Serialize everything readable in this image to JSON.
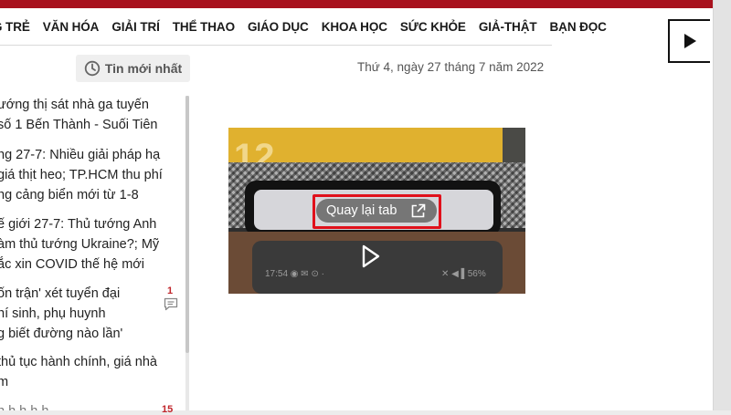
{
  "nav": {
    "items": [
      "G TRẺ",
      "VĂN HÓA",
      "GIẢI TRÍ",
      "THỂ THAO",
      "GIÁO DỤC",
      "KHOA HỌC",
      "SỨC KHỎE",
      "GIẢ-THẬT",
      "BẠN ĐỌC"
    ]
  },
  "latest_button": {
    "label": "Tin mới nhất",
    "icon": "clock-icon"
  },
  "date": "Thứ 4, ngày 27 tháng 7 năm 2022",
  "news": [
    {
      "lines": [
        "ướng thị sát nhà ga tuyến",
        "số 1 Bến Thành - Suối Tiên"
      ]
    },
    {
      "lines": [
        "ng 27-7: Nhiều giải pháp hạ",
        "giá thịt heo; TP.HCM thu phí",
        "ng cảng biển mới từ 1-8"
      ]
    },
    {
      "lines": [
        "ế giới 27-7: Thủ tướng Anh",
        "àm thủ tướng Ukraine?; Mỹ",
        "ắc xin COVID thế hệ mới"
      ]
    },
    {
      "lines": [
        "ốn trận' xét tuyển đại",
        "hí sinh, phụ huynh",
        "g biết đường nào lần'"
      ],
      "comments": "1"
    },
    {
      "lines": [
        "thủ tục hành chính, giá nhà",
        "m"
      ]
    },
    {
      "lines": [
        "h h h h h"
      ],
      "comments": "15"
    }
  ],
  "video": {
    "pip_label": "Quay lại tab",
    "screen_number": "12",
    "status_left": "17:54 ◉ ✉ ⊙ ·",
    "status_right": "✕ ◀ ▌56%"
  },
  "colors": {
    "brand_red": "#a8111d",
    "highlight": "#e0101b"
  }
}
